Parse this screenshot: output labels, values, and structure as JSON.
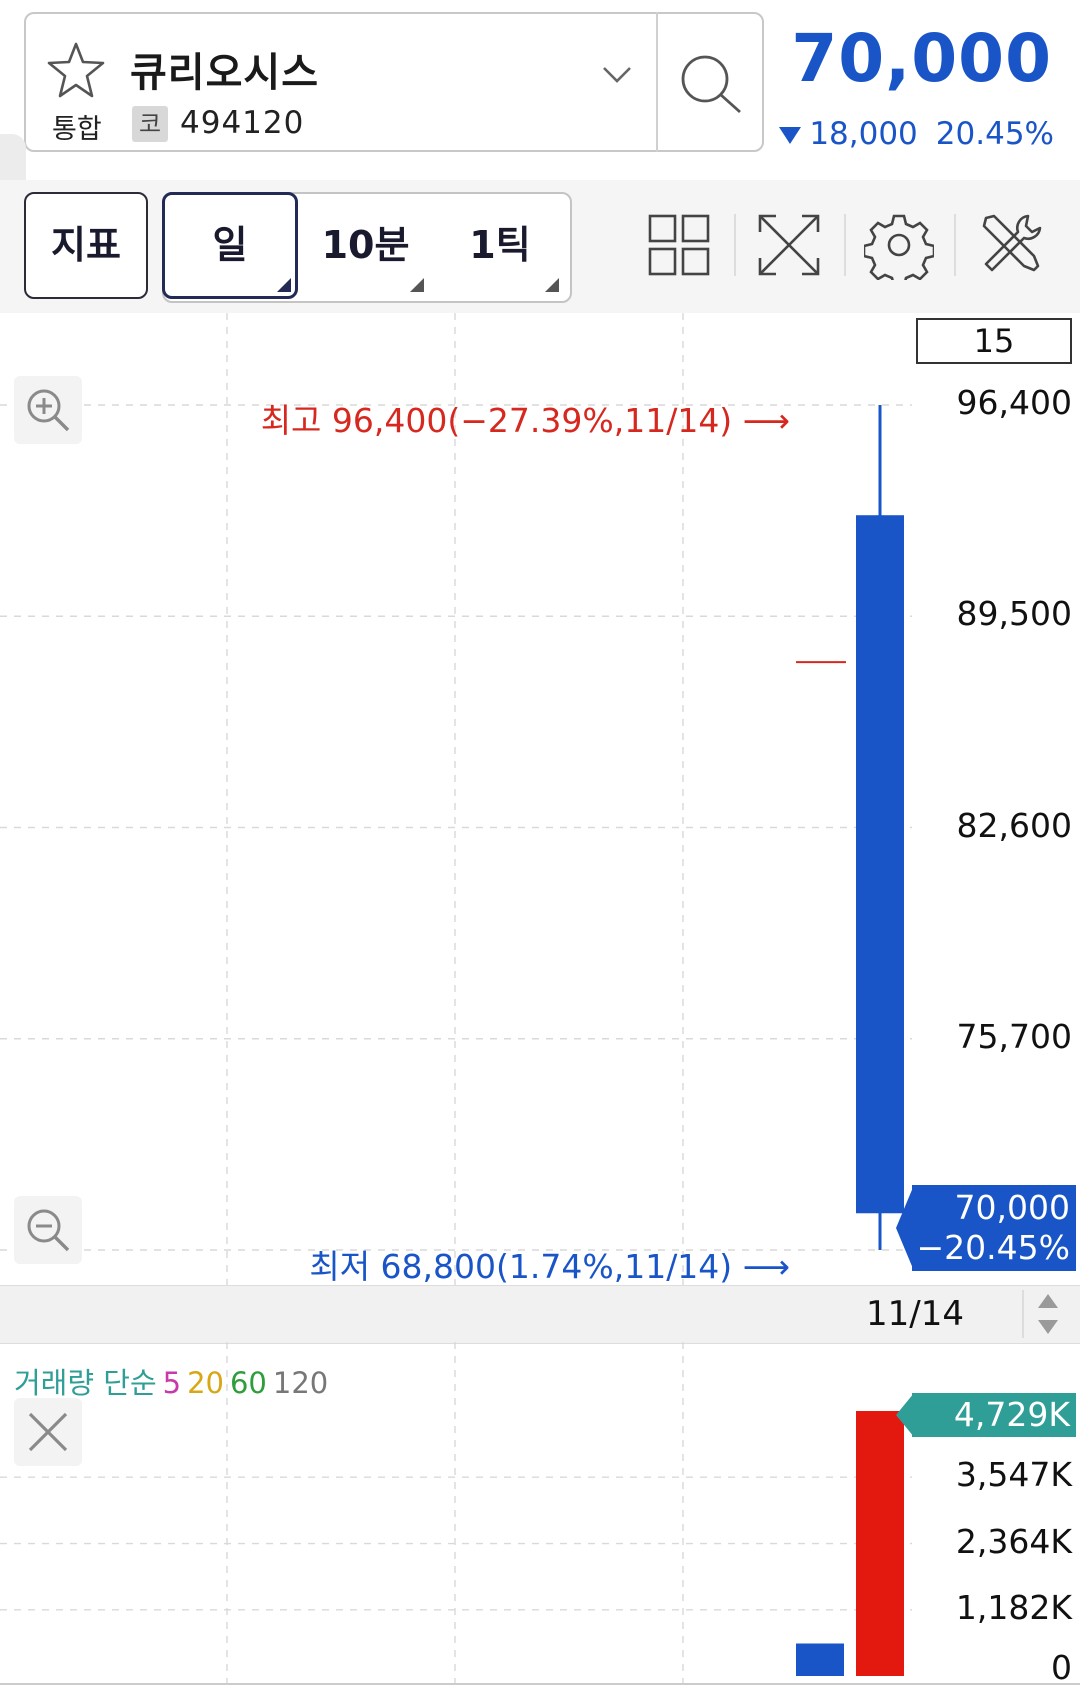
{
  "header": {
    "stock_name": "큐리오시스",
    "market": "통합",
    "code_badge": "코",
    "stock_code": "494120",
    "price": "70,000",
    "change": "18,000",
    "change_pct": "20.45%",
    "price_color": "#1a55c8"
  },
  "toolbar": {
    "indicator_label": "지표",
    "periods": [
      "일",
      "10분",
      "1틱"
    ],
    "selected_period": "일",
    "icons": [
      "layout-grid-icon",
      "fullscreen-icon",
      "settings-gear-icon",
      "tools-icon"
    ]
  },
  "chart": {
    "period_count": "15",
    "high_label": "최고 96,400(−27.39%,11/14)",
    "low_label": "최저 68,800(1.74%,11/14)",
    "current_price_box": "70,000",
    "current_pct_box": "−20.45%",
    "date_label": "11/14",
    "y_ticks": [
      "96,400",
      "89,500",
      "82,600",
      "75,700",
      "68,800"
    ]
  },
  "volume": {
    "legend_title": "거래량 단순",
    "ma_periods": [
      "5",
      "20",
      "60",
      "120"
    ],
    "ma_colors": [
      "#c93aa8",
      "#d7a716",
      "#2f9e3a",
      "#777777"
    ],
    "max_box": "4,729K",
    "ticks": [
      "3,547K",
      "2,364K",
      "1,182K",
      "0"
    ]
  },
  "chart_data": {
    "type": "candlestick",
    "date": "11/14",
    "open": 92800,
    "high": 96400,
    "low": 68800,
    "close": 70000,
    "ylim": [
      68800,
      96400
    ],
    "y_ticks": [
      68800,
      75700,
      82600,
      89500,
      96400
    ],
    "reference_price": 88000,
    "volume_ylim": [
      0,
      4729
    ],
    "volume_ticks": [
      0,
      1182,
      2364,
      3547
    ],
    "volume_bars": [
      {
        "value": 580,
        "color": "#1a55c8"
      },
      {
        "value": 4729,
        "color": "#e3180f"
      }
    ]
  }
}
